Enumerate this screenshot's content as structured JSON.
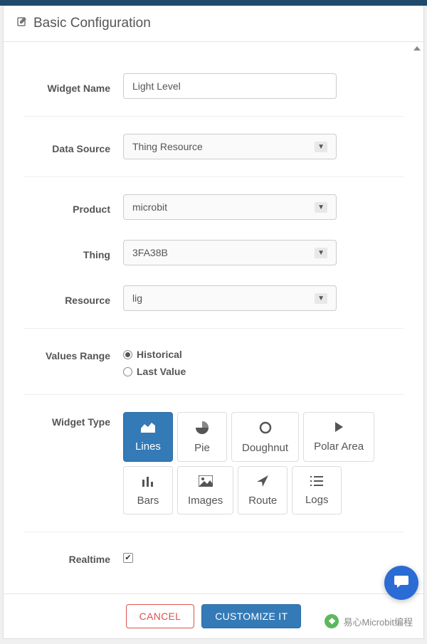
{
  "header": {
    "title": "Basic Configuration"
  },
  "form": {
    "widgetName": {
      "label": "Widget Name",
      "value": "Light Level"
    },
    "dataSource": {
      "label": "Data Source",
      "value": "Thing Resource"
    },
    "product": {
      "label": "Product",
      "value": "microbit"
    },
    "thing": {
      "label": "Thing",
      "value": "3FA38B"
    },
    "resource": {
      "label": "Resource",
      "value": "lig"
    },
    "valuesRange": {
      "label": "Values Range",
      "options": [
        {
          "label": "Historical",
          "checked": true
        },
        {
          "label": "Last Value",
          "checked": false
        }
      ]
    },
    "widgetType": {
      "label": "Widget Type",
      "types": [
        {
          "label": "Lines",
          "iconName": "chart-area-icon",
          "active": true
        },
        {
          "label": "Pie",
          "iconName": "chart-pie-icon",
          "active": false
        },
        {
          "label": "Doughnut",
          "iconName": "circle-icon",
          "active": false
        },
        {
          "label": "Polar Area",
          "iconName": "play-icon",
          "active": false
        },
        {
          "label": "Bars",
          "iconName": "chart-bar-icon",
          "active": false
        },
        {
          "label": "Images",
          "iconName": "image-icon",
          "active": false
        },
        {
          "label": "Route",
          "iconName": "location-arrow-icon",
          "active": false
        },
        {
          "label": "Logs",
          "iconName": "list-icon",
          "active": false
        }
      ]
    },
    "realtime": {
      "label": "Realtime",
      "checked": true
    }
  },
  "footer": {
    "cancel": "CANCEL",
    "customize": "CUSTOMIZE IT"
  },
  "watermark": "易心Microbit编程"
}
